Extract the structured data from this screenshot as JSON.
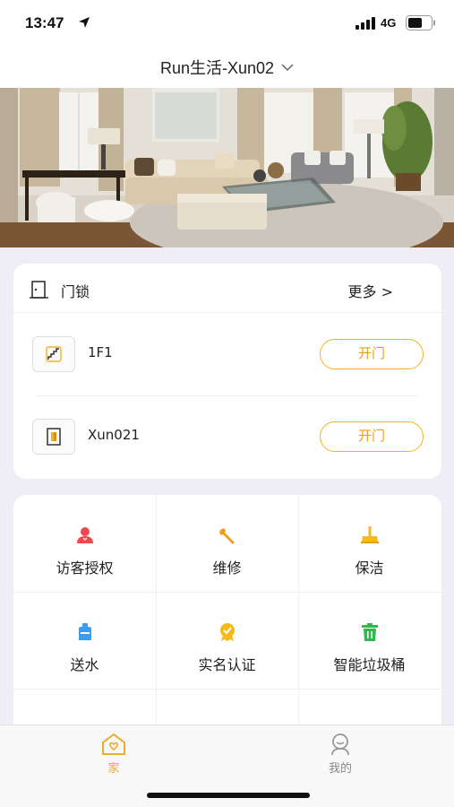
{
  "status_bar": {
    "time": "13:47",
    "network": "4G"
  },
  "nav": {
    "title": "Run生活-Xun02"
  },
  "door_lock": {
    "title": "门锁",
    "more_label": "更多 >",
    "locks": [
      {
        "name": "1F1",
        "button": "开门"
      },
      {
        "name": "Xun021",
        "button": "开门"
      }
    ]
  },
  "services": [
    {
      "label": "访客授权",
      "icon": "visitor-icon",
      "color": "#f0474f"
    },
    {
      "label": "维修",
      "icon": "wrench-icon",
      "color": "#f59a1b"
    },
    {
      "label": "保洁",
      "icon": "broom-icon",
      "color": "#f5b91b"
    },
    {
      "label": "送水",
      "icon": "water-icon",
      "color": "#3b9cf0"
    },
    {
      "label": "实名认证",
      "icon": "badge-icon",
      "color": "#f5b91b"
    },
    {
      "label": "智能垃圾桶",
      "icon": "trash-icon",
      "color": "#2fb84e"
    }
  ],
  "tab_bar": {
    "home_label": "家",
    "mine_label": "我的"
  },
  "colors": {
    "accent": "#f0a92a",
    "button_border": "#f5b11f"
  }
}
